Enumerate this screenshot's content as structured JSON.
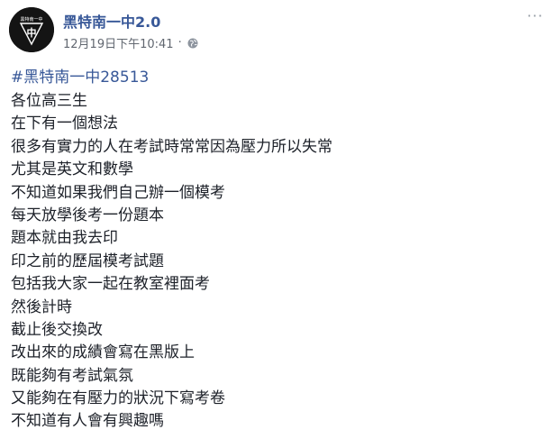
{
  "post": {
    "page_name": "黑特南一中2.0",
    "timestamp": "12月19日下午10:41",
    "separator": "·",
    "privacy_icon": "globe-icon",
    "avatar_text_top": "黑特南一中",
    "avatar_text_main": "中",
    "more_icon": "more-options-icon",
    "hashtag": "#黑特南一中28513",
    "lines": [
      "各位高三生",
      "在下有一個想法",
      "很多有實力的人在考試時常常因為壓力所以失常",
      "尤其是英文和數學",
      "不知道如果我們自己辦一個模考",
      "每天放學後考一份題本",
      "題本就由我去印",
      "印之前的歷屆模考試題",
      "包括我大家一起在教室裡面考",
      "然後計時",
      "截止後交換改",
      "改出來的成績會寫在黑版上",
      "既能夠有考試氣氛",
      "又能夠在有壓力的狀況下寫考卷",
      "不知道有人會有興趣嗎"
    ]
  },
  "colors": {
    "link": "#385898",
    "meta": "#616770",
    "text": "#1d2129"
  }
}
